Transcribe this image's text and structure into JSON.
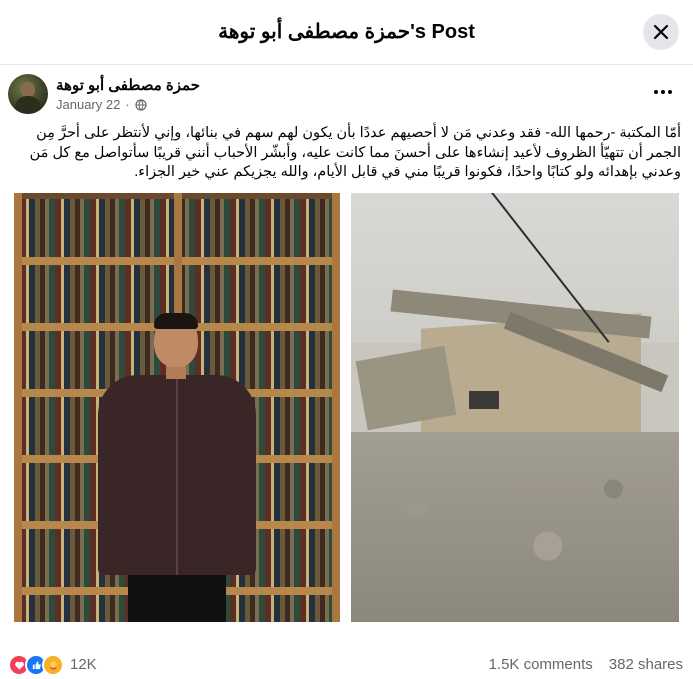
{
  "dialog": {
    "title": "حمزة مصطفى أبو توهة's Post",
    "close_icon": "close-icon"
  },
  "post": {
    "author": "حمزة مصطفى أبو توهة",
    "date": "January 22",
    "separator": "·",
    "audience_icon": "globe-icon",
    "more_icon": "more-options-icon",
    "text": "أمّا المكتبة -رحمها الله- فقد وعدني مَن لا أحصيهم عددًا بأن يكون لهم سهم في بنائها، وإني لأنتظر على أحرَّ مِن الجمر أن تتهيّأ الظروف لأعيد إنشاءها على أحسنَ مما كانت عليه، وأبشّر الأحباب أنني قريبًا سأتواصل مع كل مَن وعدني بإهدائه ولو كتابًا واحدًا، فكونوا قريبًا مني في قابل الأيام، والله يجزيكم عني خير الجزاء.",
    "photos": [
      {
        "name": "photo-man-bookshelf"
      },
      {
        "name": "photo-destroyed-building"
      }
    ]
  },
  "footer": {
    "reaction_icons": [
      "love-reaction-icon",
      "like-reaction-icon",
      "care-reaction-icon"
    ],
    "reaction_count": "12K",
    "comments": "1.5K comments",
    "shares": "382 shares"
  },
  "colors": {
    "love": "#f33e58",
    "like": "#1877f2",
    "care": "#f7b125",
    "secondary_text": "#65676b"
  }
}
